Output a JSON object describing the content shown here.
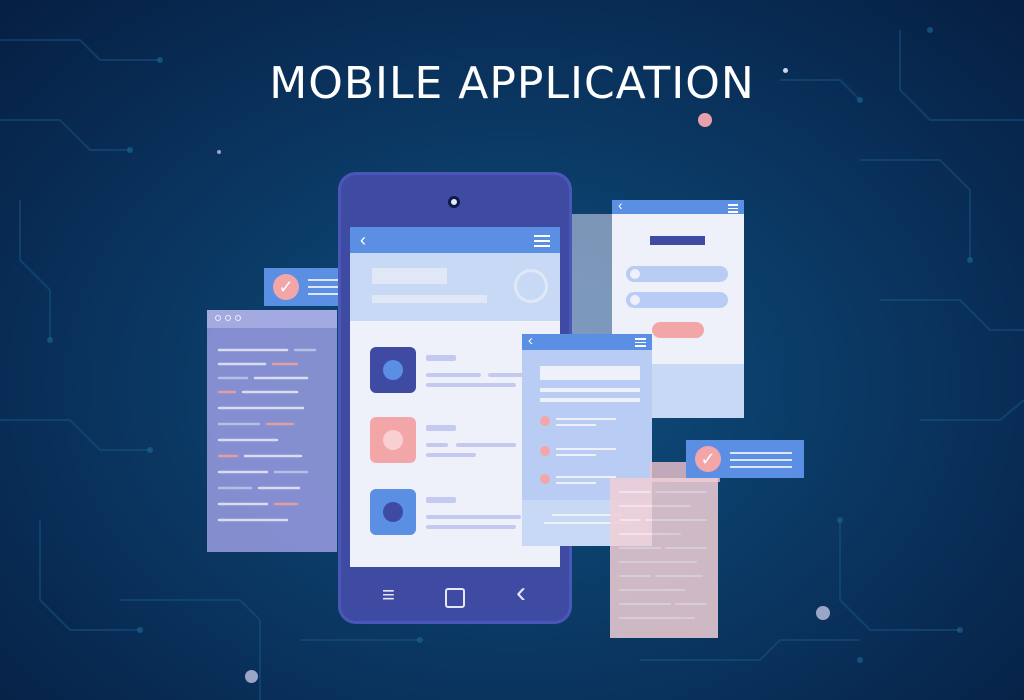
{
  "title": "MOBILE APPLICATION",
  "icons": {
    "back": "chevron-left-icon",
    "menu": "hamburger-menu-icon",
    "check": "checkmark-icon",
    "nav_menu": "menu-lines-icon",
    "nav_home": "square-home-icon",
    "nav_back": "chevron-left-icon",
    "user": "user-icon",
    "lock": "lock-icon"
  },
  "glyphs": {
    "back": "‹",
    "check": "✓",
    "nav_menu": "≡",
    "nav_home": "▢",
    "nav_back": "‹"
  },
  "colors": {
    "background": "#0b3c68",
    "phone_body": "#3f4aa3",
    "accent_blue": "#5b8fe3",
    "accent_pink": "#f2a6a8",
    "code_panel": "#8e95d8",
    "screen": "#eef0fa"
  }
}
